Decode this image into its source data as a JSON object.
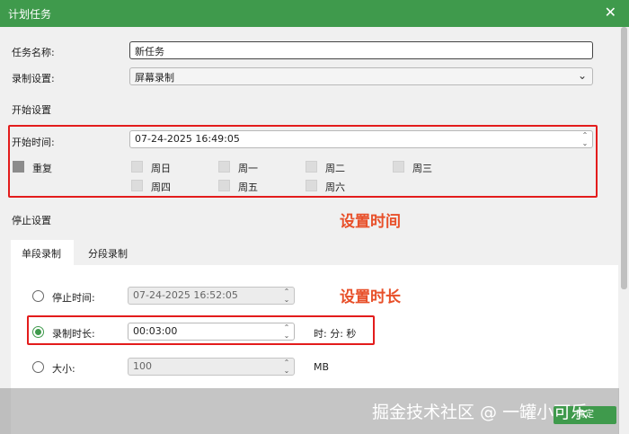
{
  "window": {
    "title": "计划任务",
    "close": "✕"
  },
  "task_name": {
    "label": "任务名称:",
    "value": "新任务"
  },
  "record_setting": {
    "label": "录制设置:",
    "value": "屏幕录制"
  },
  "start_section": {
    "heading": "开始设置",
    "label": "开始时间:",
    "value": "07-24-2025 16:49:05",
    "repeat_label": "重复",
    "days": [
      "周日",
      "周一",
      "周二",
      "周三",
      "周四",
      "周五",
      "周六"
    ]
  },
  "stop_section": {
    "heading": "停止设置",
    "tabs": [
      "单段录制",
      "分段录制"
    ],
    "stop_time": {
      "label": "停止时间:",
      "value": "07-24-2025 16:52:05"
    },
    "duration": {
      "label": "录制时长:",
      "value": "00:03:00",
      "unit": "时: 分: 秒"
    },
    "size": {
      "label": "大小:",
      "value": "100",
      "unit": "MB"
    }
  },
  "annotations": {
    "set_time": "设置时间",
    "set_duration": "设置时长"
  },
  "footer": {
    "ok": "确定",
    "watermark": "掘金技术社区 @ 一罐小可乐"
  },
  "colors": {
    "accent": "#3f9a4c",
    "highlight": "#e31c1c",
    "annotation": "#e8502a"
  }
}
